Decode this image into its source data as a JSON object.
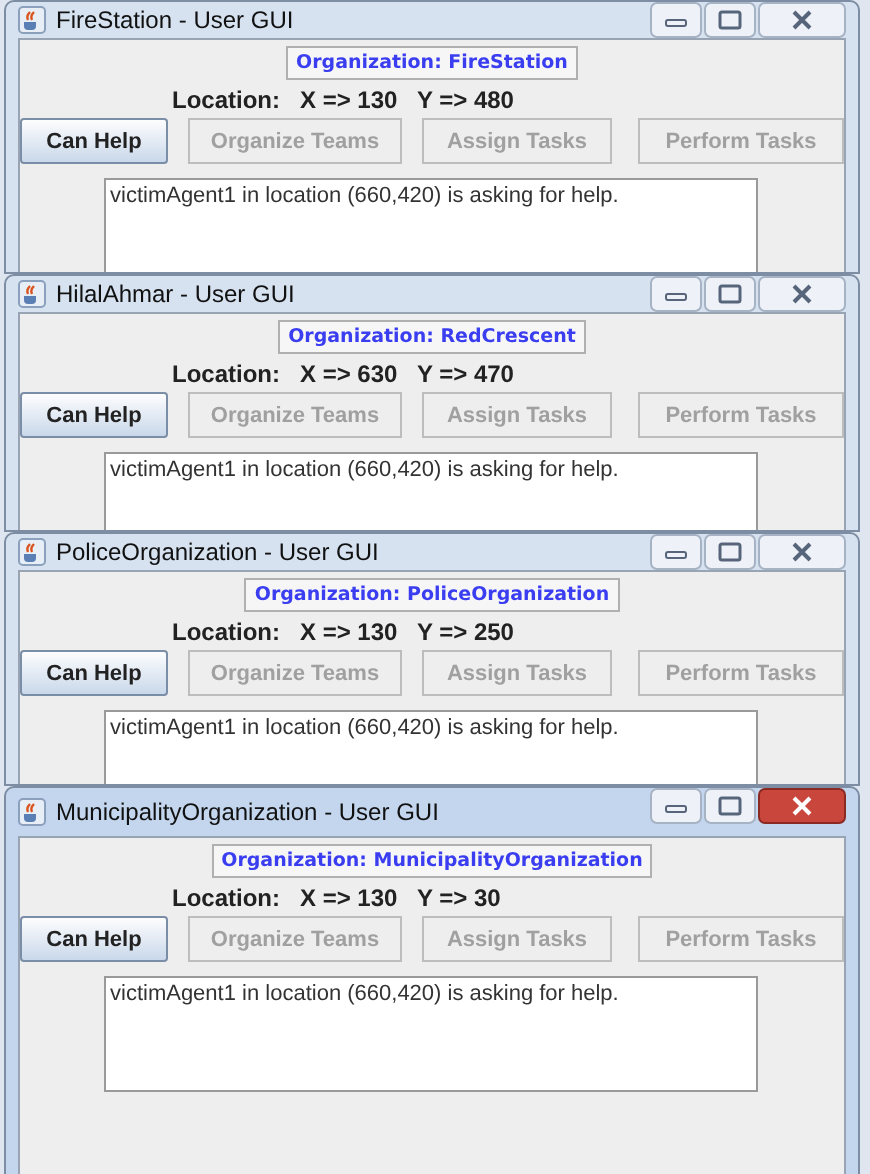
{
  "windows": [
    {
      "title": "FireStation - User GUI",
      "active": false,
      "organization": "Organization: FireStation",
      "location": "Location:   X => 130   Y => 480",
      "buttons": [
        {
          "label": "Can Help",
          "enabled": true
        },
        {
          "label": "Organize Teams",
          "enabled": false
        },
        {
          "label": "Assign Tasks",
          "enabled": false
        },
        {
          "label": "Perform Tasks",
          "enabled": false
        }
      ],
      "message": "victimAgent1 in location (660,420) is asking for help."
    },
    {
      "title": "HilalAhmar - User GUI",
      "active": false,
      "organization": "Organization: RedCrescent",
      "location": "Location:   X => 630   Y => 470",
      "buttons": [
        {
          "label": "Can Help",
          "enabled": true
        },
        {
          "label": "Organize Teams",
          "enabled": false
        },
        {
          "label": "Assign Tasks",
          "enabled": false
        },
        {
          "label": "Perform Tasks",
          "enabled": false
        }
      ],
      "message": "victimAgent1 in location (660,420) is asking for help."
    },
    {
      "title": "PoliceOrganization - User GUI",
      "active": false,
      "organization": "Organization: PoliceOrganization",
      "location": "Location:   X => 130   Y => 250",
      "buttons": [
        {
          "label": "Can Help",
          "enabled": true
        },
        {
          "label": "Organize Teams",
          "enabled": false
        },
        {
          "label": "Assign Tasks",
          "enabled": false
        },
        {
          "label": "Perform Tasks",
          "enabled": false
        }
      ],
      "message": "victimAgent1 in location (660,420) is asking for help."
    },
    {
      "title": "MunicipalityOrganization - User GUI",
      "active": true,
      "organization": "Organization: MunicipalityOrganization",
      "location": "Location:   X => 130   Y => 30",
      "buttons": [
        {
          "label": "Can Help",
          "enabled": true
        },
        {
          "label": "Organize Teams",
          "enabled": false
        },
        {
          "label": "Assign Tasks",
          "enabled": false
        },
        {
          "label": "Perform Tasks",
          "enabled": false
        }
      ],
      "message": "victimAgent1 in location (660,420) is asking for help."
    }
  ]
}
